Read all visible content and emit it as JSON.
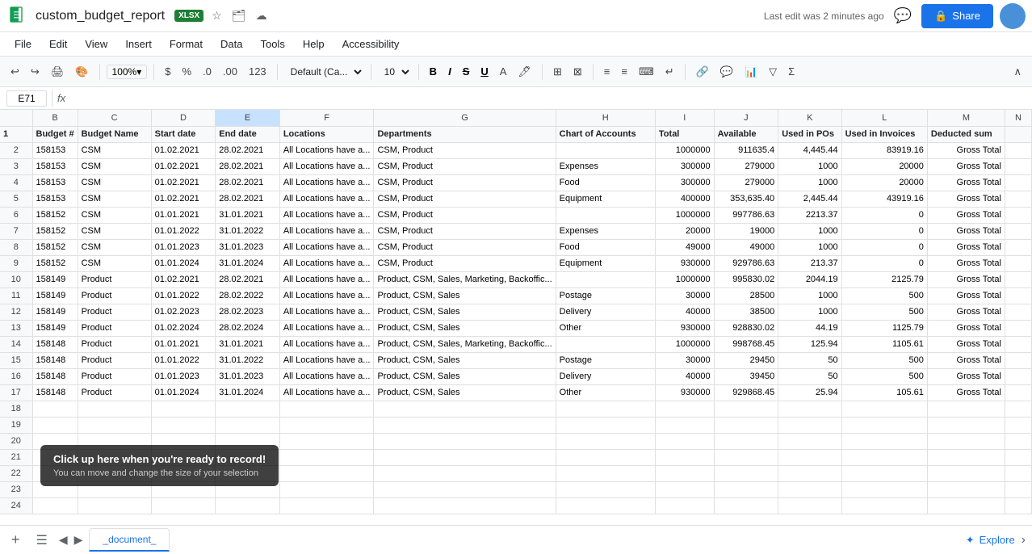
{
  "app": {
    "icon": "sheets-icon",
    "title": "custom_budget_report",
    "badge": "XLSX",
    "last_edit": "Last edit was 2 minutes ago",
    "share_label": "Share",
    "comments_icon": "💬"
  },
  "menu": {
    "items": [
      "File",
      "Edit",
      "View",
      "Insert",
      "Format",
      "Data",
      "Tools",
      "Help",
      "Accessibility"
    ]
  },
  "toolbar": {
    "zoom": "100%",
    "currency_symbol": "$",
    "percent_symbol": "%",
    "decimal_add": ".0",
    "decimal_remove": ".00",
    "format_123": "123",
    "font_family": "Default (Ca...",
    "font_size": "10"
  },
  "formula_bar": {
    "cell_ref": "E71",
    "fx": "fx"
  },
  "columns": {
    "headers": [
      "",
      "B",
      "C",
      "D",
      "E",
      "F",
      "G",
      "H",
      "I",
      "J",
      "K",
      "L",
      "M",
      "N"
    ]
  },
  "header_row": {
    "budget_hash": "Budget #",
    "budget_name": "Budget Name",
    "start_date": "Start date",
    "end_date": "End date",
    "locations": "Locations",
    "departments": "Departments",
    "chart_of_accounts": "Chart of Accounts",
    "total": "Total",
    "available": "Available",
    "used_in_pos": "Used in POs",
    "used_in_invoices": "Used in Invoices",
    "deducted_sum": "Deducted sum"
  },
  "rows": [
    {
      "num": 2,
      "b": "158153",
      "c": "CSM",
      "d": "01.02.2021",
      "e": "28.02.2021",
      "f": "All Locations have a...",
      "g": "CSM, Product",
      "h": "",
      "i": "1000000",
      "j": "911635.4",
      "k": "4,445.44",
      "l": "83919.16",
      "m": "Gross Total"
    },
    {
      "num": 3,
      "b": "158153",
      "c": "CSM",
      "d": "01.02.2021",
      "e": "28.02.2021",
      "f": "All Locations have a...",
      "g": "CSM, Product",
      "h": "Expenses",
      "i": "300000",
      "j": "279000",
      "k": "1000",
      "l": "20000",
      "m": "Gross Total"
    },
    {
      "num": 4,
      "b": "158153",
      "c": "CSM",
      "d": "01.02.2021",
      "e": "28.02.2021",
      "f": "All Locations have a...",
      "g": "CSM, Product",
      "h": "Food",
      "i": "300000",
      "j": "279000",
      "k": "1000",
      "l": "20000",
      "m": "Gross Total"
    },
    {
      "num": 5,
      "b": "158153",
      "c": "CSM",
      "d": "01.02.2021",
      "e": "28.02.2021",
      "f": "All Locations have a...",
      "g": "CSM, Product",
      "h": "Equipment",
      "i": "400000",
      "j": "353,635.40",
      "k": "2,445.44",
      "l": "43919.16",
      "m": "Gross Total"
    },
    {
      "num": 6,
      "b": "158152",
      "c": "CSM",
      "d": "01.01.2021",
      "e": "31.01.2021",
      "f": "All Locations have a...",
      "g": "CSM, Product",
      "h": "",
      "i": "1000000",
      "j": "997786.63",
      "k": "2213.37",
      "l": "0",
      "m": "Gross Total"
    },
    {
      "num": 7,
      "b": "158152",
      "c": "CSM",
      "d": "01.01.2022",
      "e": "31.01.2022",
      "f": "All Locations have a...",
      "g": "CSM, Product",
      "h": "Expenses",
      "i": "20000",
      "j": "19000",
      "k": "1000",
      "l": "0",
      "m": "Gross Total"
    },
    {
      "num": 8,
      "b": "158152",
      "c": "CSM",
      "d": "01.01.2023",
      "e": "31.01.2023",
      "f": "All Locations have a...",
      "g": "CSM, Product",
      "h": "Food",
      "i": "49000",
      "j": "49000",
      "k": "1000",
      "l": "0",
      "m": "Gross Total"
    },
    {
      "num": 9,
      "b": "158152",
      "c": "CSM",
      "d": "01.01.2024",
      "e": "31.01.2024",
      "f": "All Locations have a...",
      "g": "CSM, Product",
      "h": "Equipment",
      "i": "930000",
      "j": "929786.63",
      "k": "213.37",
      "l": "0",
      "m": "Gross Total"
    },
    {
      "num": 10,
      "b": "158149",
      "c": "Product",
      "d": "01.02.2021",
      "e": "28.02.2021",
      "f": "All Locations have a...",
      "g": "Product, CSM, Sales, Marketing, Backoffic...",
      "h": "",
      "i": "1000000",
      "j": "995830.02",
      "k": "2044.19",
      "l": "2125.79",
      "m": "Gross Total"
    },
    {
      "num": 11,
      "b": "158149",
      "c": "Product",
      "d": "01.01.2022",
      "e": "28.02.2022",
      "f": "All Locations have a...",
      "g": "Product, CSM, Sales",
      "h": "Postage",
      "i": "30000",
      "j": "28500",
      "k": "1000",
      "l": "500",
      "m": "Gross Total"
    },
    {
      "num": 12,
      "b": "158149",
      "c": "Product",
      "d": "01.02.2023",
      "e": "28.02.2023",
      "f": "All Locations have a...",
      "g": "Product, CSM, Sales",
      "h": "Delivery",
      "i": "40000",
      "j": "38500",
      "k": "1000",
      "l": "500",
      "m": "Gross Total"
    },
    {
      "num": 13,
      "b": "158149",
      "c": "Product",
      "d": "01.02.2024",
      "e": "28.02.2024",
      "f": "All Locations have a...",
      "g": "Product, CSM, Sales",
      "h": "Other",
      "i": "930000",
      "j": "928830.02",
      "k": "44.19",
      "l": "1125.79",
      "m": "Gross Total"
    },
    {
      "num": 14,
      "b": "158148",
      "c": "Product",
      "d": "01.01.2021",
      "e": "31.01.2021",
      "f": "All Locations have a...",
      "g": "Product, CSM, Sales, Marketing, Backoffic...",
      "h": "",
      "i": "1000000",
      "j": "998768.45",
      "k": "125.94",
      "l": "1105.61",
      "m": "Gross Total"
    },
    {
      "num": 15,
      "b": "158148",
      "c": "Product",
      "d": "01.01.2022",
      "e": "31.01.2022",
      "f": "All Locations have a...",
      "g": "Product, CSM, Sales",
      "h": "Postage",
      "i": "30000",
      "j": "29450",
      "k": "50",
      "l": "500",
      "m": "Gross Total"
    },
    {
      "num": 16,
      "b": "158148",
      "c": "Product",
      "d": "01.01.2023",
      "e": "31.01.2023",
      "f": "All Locations have a...",
      "g": "Product, CSM, Sales",
      "h": "Delivery",
      "i": "40000",
      "j": "39450",
      "k": "50",
      "l": "500",
      "m": "Gross Total"
    },
    {
      "num": 17,
      "b": "158148",
      "c": "Product",
      "d": "01.01.2024",
      "e": "31.01.2024",
      "f": "All Locations have a...",
      "g": "Product, CSM, Sales",
      "h": "Other",
      "i": "930000",
      "j": "929868.45",
      "k": "25.94",
      "l": "105.61",
      "m": "Gross Total"
    },
    {
      "num": 18,
      "b": "",
      "c": "",
      "d": "",
      "e": "",
      "f": "",
      "g": "",
      "h": "",
      "i": "",
      "j": "",
      "k": "",
      "l": "",
      "m": ""
    },
    {
      "num": 19,
      "b": "",
      "c": "",
      "d": "",
      "e": "",
      "f": "",
      "g": "",
      "h": "",
      "i": "",
      "j": "",
      "k": "",
      "l": "",
      "m": ""
    },
    {
      "num": 20,
      "b": "",
      "c": "",
      "d": "",
      "e": "",
      "f": "",
      "g": "",
      "h": "",
      "i": "",
      "j": "",
      "k": "",
      "l": "",
      "m": ""
    },
    {
      "num": 21,
      "b": "",
      "c": "",
      "d": "",
      "e": "",
      "f": "",
      "g": "",
      "h": "",
      "i": "",
      "j": "",
      "k": "",
      "l": "",
      "m": ""
    },
    {
      "num": 22,
      "b": "",
      "c": "",
      "d": "",
      "e": "",
      "f": "",
      "g": "",
      "h": "",
      "i": "",
      "j": "",
      "k": "",
      "l": "",
      "m": ""
    },
    {
      "num": 23,
      "b": "",
      "c": "",
      "d": "",
      "e": "",
      "f": "",
      "g": "",
      "h": "",
      "i": "",
      "j": "",
      "k": "",
      "l": "",
      "m": ""
    },
    {
      "num": 24,
      "b": "",
      "c": "",
      "d": "",
      "e": "",
      "f": "",
      "g": "",
      "h": "",
      "i": "",
      "j": "",
      "k": "",
      "l": "",
      "m": ""
    }
  ],
  "tooltip": {
    "title": "Click up here when you're ready to record!",
    "subtitle": "You can move and change the size of your selection"
  },
  "bottom_bar": {
    "add_sheet_label": "+",
    "sheets": [
      {
        "name": "_document_",
        "active": true
      }
    ],
    "explore_label": "Explore"
  },
  "colors": {
    "accent": "#1a73e8",
    "green_badge": "#1e7e34",
    "toolbar_bg": "#f8f9fa",
    "border": "#e0e0e0"
  }
}
